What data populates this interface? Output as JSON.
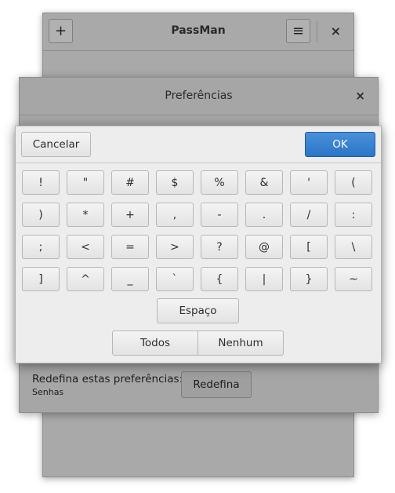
{
  "main_window": {
    "title": "PassMan",
    "add_icon": "+",
    "menu_icon": "≡",
    "close_icon": "×"
  },
  "preferences_window": {
    "title": "Preferências",
    "close_icon": "×",
    "reset_label": "Redefina estas preferências:",
    "reset_sublabel": "Senhas",
    "reset_button": "Redefina"
  },
  "char_dialog": {
    "cancel_label": "Cancelar",
    "ok_label": "OK",
    "keys": [
      "!",
      "\"",
      "#",
      "$",
      "%",
      "&",
      "'",
      "(",
      ")",
      "*",
      "+",
      ",",
      "-",
      ".",
      "/",
      ":",
      ";",
      "<",
      "=",
      ">",
      "?",
      "@",
      "[",
      "\\",
      "]",
      "^",
      "_",
      "`",
      "{",
      "|",
      "}",
      "~"
    ],
    "space_label": "Espaço",
    "all_label": "Todos",
    "none_label": "Nenhum"
  }
}
